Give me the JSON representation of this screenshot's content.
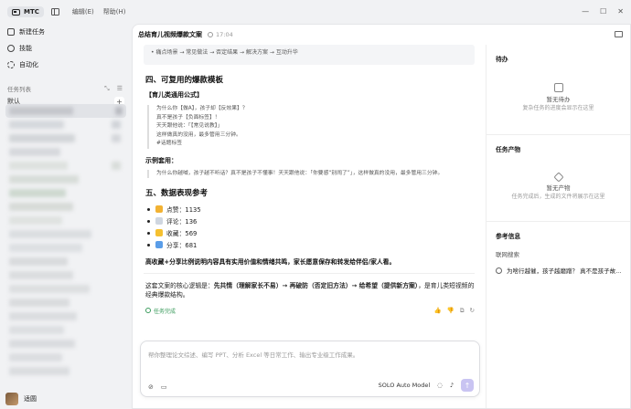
{
  "app": {
    "name": "MTC",
    "menu": [
      "编辑(E)",
      "帮助(H)"
    ]
  },
  "window_controls": [
    "—",
    "☐",
    "✕"
  ],
  "sidebar": {
    "nav": [
      {
        "label": "新建任务",
        "icon": "new-task-icon"
      },
      {
        "label": "技能",
        "icon": "skill-icon"
      },
      {
        "label": "自动化",
        "icon": "automation-icon"
      }
    ],
    "task_list_label": "任务列表",
    "default_label": "默认",
    "add": "+",
    "user": "适圆"
  },
  "main": {
    "title": "总结育儿视频爆款文案",
    "time": "17:04",
    "cut_text": "• 痛点场景 → 常见做法 → 否定结果 → 解决方案 → 互动升华",
    "section4_title": "四、可复用的爆款模板",
    "formula_title": "【育儿类通用公式】",
    "formula_lines": [
      "为什么你【做A】，孩子却【反效果】？",
      "真不是孩子【负面标签】！",
      "天天跟他说：「【常见说教】」",
      "这样做真的没用，最多管用三分钟。",
      "#话题标签"
    ],
    "example_title": "示例套用：",
    "example_line": "为什么你越喊，孩子越不听话？真不是孩子不懂事！天天跟他说：「你要感“别闹了”」，这样做真的没用，最多管用三分钟。",
    "section5_title": "五、数据表现参考",
    "stats": [
      {
        "label": "点赞：1135",
        "icon": "thumbs-up-icon",
        "color": "#f2b233"
      },
      {
        "label": "评论：136",
        "icon": "comment-icon",
        "color": "#cfd6e0"
      },
      {
        "label": "收藏：569",
        "icon": "star-icon",
        "color": "#f5c030"
      },
      {
        "label": "分享：681",
        "icon": "share-icon",
        "color": "#5a9de8"
      }
    ],
    "insight": "高收藏+分享比例说明内容具有实用价值和情绪共鸣，家长愿意保存和转发给伴侣/家人看。",
    "summary_prefix": "这套文案的核心逻辑是：",
    "summary_bold": "先共情（理解家长不易）→ 再破防（否定旧方法）→ 给希望（提供新方案）",
    "summary_suffix": "，是育儿类短视频的经典爆款结构。",
    "done_label": "任务完成",
    "feedback_icons": [
      "👍",
      "👎",
      "⧉",
      "↻"
    ]
  },
  "input": {
    "placeholder": "帮你整理论文综述、编写 PPT、分析 Excel 等日常工作、输出专业级工作成果。",
    "model": "SOLO Auto Model",
    "send": "↑"
  },
  "right_panel": {
    "todo_title": "待办",
    "todo_empty": "暂无待办",
    "todo_hint": "复杂任务的进度会显示在这里",
    "output_title": "任务产物",
    "output_empty": "暂无产物",
    "output_hint": "任务完成后，生成的文件将展示在这里",
    "ref_title": "参考信息",
    "ref_sub": "联网搜索",
    "ref_item": "为啥行越催，孩子越磨蹭？ 真不是孩子故..."
  },
  "colors": {
    "accent": "#c9c4f2",
    "success": "#3a9b5c"
  }
}
